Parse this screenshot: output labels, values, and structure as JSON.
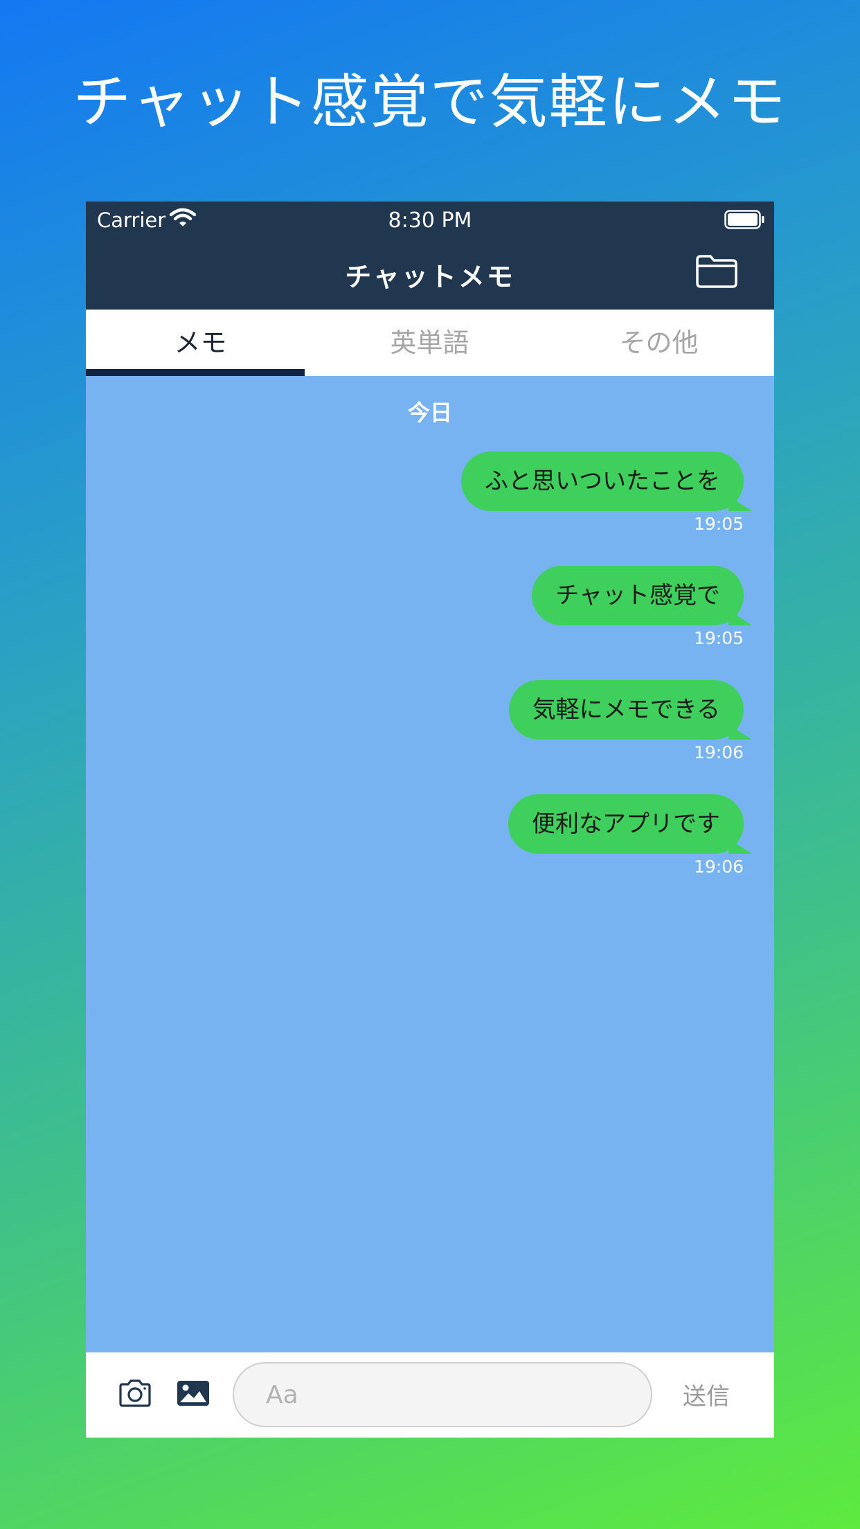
{
  "headline": "チャット感覚で気軽にメモ",
  "status_bar": {
    "carrier": "Carrier",
    "time": "8:30 PM"
  },
  "nav": {
    "title": "チャットメモ",
    "folder_icon": "folder-icon"
  },
  "tabs": [
    {
      "label": "メモ",
      "active": true
    },
    {
      "label": "英単語",
      "active": false
    },
    {
      "label": "その他",
      "active": false
    }
  ],
  "chat": {
    "date_label": "今日",
    "messages": [
      {
        "text": "ふと思いついたことを",
        "time": "19:05"
      },
      {
        "text": "チャット感覚で",
        "time": "19:05"
      },
      {
        "text": "気軽にメモできる",
        "time": "19:06"
      },
      {
        "text": "便利なアプリです",
        "time": "19:06"
      }
    ]
  },
  "input": {
    "placeholder": "Aa",
    "send_label": "送信",
    "camera_icon": "camera-icon",
    "photo_icon": "photo-icon"
  },
  "colors": {
    "nav_bg": "#213750",
    "chat_bg": "#77b3f1",
    "bubble": "#3fcf5c",
    "tab_indicator": "#0f2440"
  }
}
